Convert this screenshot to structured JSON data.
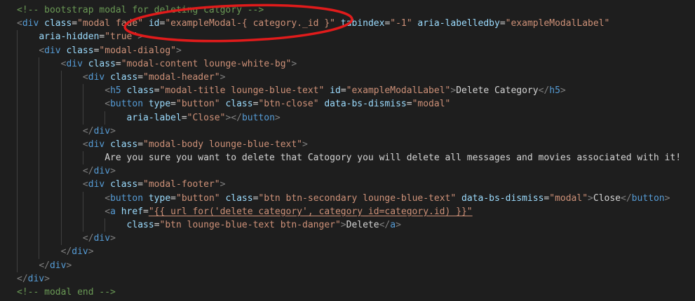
{
  "colors": {
    "background": "#1e1e1e",
    "punctuation": "#808080",
    "tag": "#569cd6",
    "attribute": "#9cdcfe",
    "string": "#ce9178",
    "text": "#d4d4d4",
    "comment": "#6a9955",
    "annotation": "#e01b1b"
  },
  "lines": [
    {
      "indent": 0,
      "tokens": [
        {
          "t": "comment",
          "v": "<!-- bootstrap modal for deleting catgory -->"
        }
      ]
    },
    {
      "indent": 0,
      "tokens": [
        {
          "t": "punct",
          "v": "<"
        },
        {
          "t": "tag",
          "v": "div"
        },
        {
          "t": "text",
          "v": " "
        },
        {
          "t": "attr",
          "v": "class"
        },
        {
          "t": "eq",
          "v": "="
        },
        {
          "t": "str",
          "v": "\"modal fade\""
        },
        {
          "t": "text",
          "v": " "
        },
        {
          "t": "attr",
          "v": "id"
        },
        {
          "t": "eq",
          "v": "="
        },
        {
          "t": "str",
          "v": "\"exampleModal-{ category._id }\""
        },
        {
          "t": "text",
          "v": " "
        },
        {
          "t": "attr",
          "v": "tabindex"
        },
        {
          "t": "eq",
          "v": "="
        },
        {
          "t": "str",
          "v": "\"-1\""
        },
        {
          "t": "text",
          "v": " "
        },
        {
          "t": "attr",
          "v": "aria-labelledby"
        },
        {
          "t": "eq",
          "v": "="
        },
        {
          "t": "str",
          "v": "\"exampleModalLabel\""
        }
      ]
    },
    {
      "indent": 1,
      "tokens": [
        {
          "t": "attr",
          "v": "aria-hidden"
        },
        {
          "t": "eq",
          "v": "="
        },
        {
          "t": "str",
          "v": "\"true\""
        },
        {
          "t": "punct",
          "v": ">"
        }
      ]
    },
    {
      "indent": 1,
      "tokens": [
        {
          "t": "punct",
          "v": "<"
        },
        {
          "t": "tag",
          "v": "div"
        },
        {
          "t": "text",
          "v": " "
        },
        {
          "t": "attr",
          "v": "class"
        },
        {
          "t": "eq",
          "v": "="
        },
        {
          "t": "str",
          "v": "\"modal-dialog\""
        },
        {
          "t": "punct",
          "v": ">"
        }
      ]
    },
    {
      "indent": 2,
      "tokens": [
        {
          "t": "punct",
          "v": "<"
        },
        {
          "t": "tag",
          "v": "div"
        },
        {
          "t": "text",
          "v": " "
        },
        {
          "t": "attr",
          "v": "class"
        },
        {
          "t": "eq",
          "v": "="
        },
        {
          "t": "str",
          "v": "\"modal-content lounge-white-bg\""
        },
        {
          "t": "punct",
          "v": ">"
        }
      ]
    },
    {
      "indent": 3,
      "tokens": [
        {
          "t": "punct",
          "v": "<"
        },
        {
          "t": "tag",
          "v": "div"
        },
        {
          "t": "text",
          "v": " "
        },
        {
          "t": "attr",
          "v": "class"
        },
        {
          "t": "eq",
          "v": "="
        },
        {
          "t": "str",
          "v": "\"modal-header\""
        },
        {
          "t": "punct",
          "v": ">"
        }
      ]
    },
    {
      "indent": 4,
      "tokens": [
        {
          "t": "punct",
          "v": "<"
        },
        {
          "t": "tag",
          "v": "h5"
        },
        {
          "t": "text",
          "v": " "
        },
        {
          "t": "attr",
          "v": "class"
        },
        {
          "t": "eq",
          "v": "="
        },
        {
          "t": "str",
          "v": "\"modal-title lounge-blue-text\""
        },
        {
          "t": "text",
          "v": " "
        },
        {
          "t": "attr",
          "v": "id"
        },
        {
          "t": "eq",
          "v": "="
        },
        {
          "t": "str",
          "v": "\"exampleModalLabel\""
        },
        {
          "t": "punct",
          "v": ">"
        },
        {
          "t": "text",
          "v": "Delete Category"
        },
        {
          "t": "punct",
          "v": "</"
        },
        {
          "t": "tag",
          "v": "h5"
        },
        {
          "t": "punct",
          "v": ">"
        }
      ]
    },
    {
      "indent": 4,
      "tokens": [
        {
          "t": "punct",
          "v": "<"
        },
        {
          "t": "tag",
          "v": "button"
        },
        {
          "t": "text",
          "v": " "
        },
        {
          "t": "attr",
          "v": "type"
        },
        {
          "t": "eq",
          "v": "="
        },
        {
          "t": "str",
          "v": "\"button\""
        },
        {
          "t": "text",
          "v": " "
        },
        {
          "t": "attr",
          "v": "class"
        },
        {
          "t": "eq",
          "v": "="
        },
        {
          "t": "str",
          "v": "\"btn-close\""
        },
        {
          "t": "text",
          "v": " "
        },
        {
          "t": "attr",
          "v": "data-bs-dismiss"
        },
        {
          "t": "eq",
          "v": "="
        },
        {
          "t": "str",
          "v": "\"modal\""
        }
      ]
    },
    {
      "indent": 5,
      "tokens": [
        {
          "t": "attr",
          "v": "aria-label"
        },
        {
          "t": "eq",
          "v": "="
        },
        {
          "t": "str",
          "v": "\"Close\""
        },
        {
          "t": "punct",
          "v": "></"
        },
        {
          "t": "tag",
          "v": "button"
        },
        {
          "t": "punct",
          "v": ">"
        }
      ]
    },
    {
      "indent": 3,
      "tokens": [
        {
          "t": "punct",
          "v": "</"
        },
        {
          "t": "tag",
          "v": "div"
        },
        {
          "t": "punct",
          "v": ">"
        }
      ]
    },
    {
      "indent": 3,
      "tokens": [
        {
          "t": "punct",
          "v": "<"
        },
        {
          "t": "tag",
          "v": "div"
        },
        {
          "t": "text",
          "v": " "
        },
        {
          "t": "attr",
          "v": "class"
        },
        {
          "t": "eq",
          "v": "="
        },
        {
          "t": "str",
          "v": "\"modal-body lounge-blue-text\""
        },
        {
          "t": "punct",
          "v": ">"
        }
      ]
    },
    {
      "indent": 4,
      "tokens": [
        {
          "t": "text",
          "v": "Are you sure you want to delete that Catogory you will delete all messages and movies associated with it!"
        }
      ]
    },
    {
      "indent": 3,
      "tokens": [
        {
          "t": "punct",
          "v": "</"
        },
        {
          "t": "tag",
          "v": "div"
        },
        {
          "t": "punct",
          "v": ">"
        }
      ]
    },
    {
      "indent": 3,
      "tokens": [
        {
          "t": "punct",
          "v": "<"
        },
        {
          "t": "tag",
          "v": "div"
        },
        {
          "t": "text",
          "v": " "
        },
        {
          "t": "attr",
          "v": "class"
        },
        {
          "t": "eq",
          "v": "="
        },
        {
          "t": "str",
          "v": "\"modal-footer\""
        },
        {
          "t": "punct",
          "v": ">"
        }
      ]
    },
    {
      "indent": 4,
      "tokens": [
        {
          "t": "punct",
          "v": "<"
        },
        {
          "t": "tag",
          "v": "button"
        },
        {
          "t": "text",
          "v": " "
        },
        {
          "t": "attr",
          "v": "type"
        },
        {
          "t": "eq",
          "v": "="
        },
        {
          "t": "str",
          "v": "\"button\""
        },
        {
          "t": "text",
          "v": " "
        },
        {
          "t": "attr",
          "v": "class"
        },
        {
          "t": "eq",
          "v": "="
        },
        {
          "t": "str",
          "v": "\"btn btn-secondary lounge-blue-text\""
        },
        {
          "t": "text",
          "v": " "
        },
        {
          "t": "attr",
          "v": "data-bs-dismiss"
        },
        {
          "t": "eq",
          "v": "="
        },
        {
          "t": "str",
          "v": "\"modal\""
        },
        {
          "t": "punct",
          "v": ">"
        },
        {
          "t": "text",
          "v": "Close"
        },
        {
          "t": "punct",
          "v": "</"
        },
        {
          "t": "tag",
          "v": "button"
        },
        {
          "t": "punct",
          "v": ">"
        }
      ]
    },
    {
      "indent": 4,
      "tokens": [
        {
          "t": "punct",
          "v": "<"
        },
        {
          "t": "tag",
          "v": "a"
        },
        {
          "t": "text",
          "v": " "
        },
        {
          "t": "attr",
          "v": "href"
        },
        {
          "t": "eq",
          "v": "="
        },
        {
          "t": "str",
          "v": "\"{{ url_for('delete_category', category_id=category.id) }}\"",
          "link": true
        }
      ]
    },
    {
      "indent": 5,
      "tokens": [
        {
          "t": "attr",
          "v": "class"
        },
        {
          "t": "eq",
          "v": "="
        },
        {
          "t": "str",
          "v": "\"btn lounge-blue-text btn-danger\""
        },
        {
          "t": "punct",
          "v": ">"
        },
        {
          "t": "text",
          "v": "Delete"
        },
        {
          "t": "punct",
          "v": "</"
        },
        {
          "t": "tag",
          "v": "a"
        },
        {
          "t": "punct",
          "v": ">"
        }
      ]
    },
    {
      "indent": 3,
      "tokens": [
        {
          "t": "punct",
          "v": "</"
        },
        {
          "t": "tag",
          "v": "div"
        },
        {
          "t": "punct",
          "v": ">"
        }
      ]
    },
    {
      "indent": 2,
      "tokens": [
        {
          "t": "punct",
          "v": "</"
        },
        {
          "t": "tag",
          "v": "div"
        },
        {
          "t": "punct",
          "v": ">"
        }
      ]
    },
    {
      "indent": 1,
      "tokens": [
        {
          "t": "punct",
          "v": "</"
        },
        {
          "t": "tag",
          "v": "div"
        },
        {
          "t": "punct",
          "v": ">"
        }
      ]
    },
    {
      "indent": 0,
      "tokens": [
        {
          "t": "punct",
          "v": "</"
        },
        {
          "t": "tag",
          "v": "div"
        },
        {
          "t": "punct",
          "v": ">"
        }
      ]
    },
    {
      "indent": 0,
      "tokens": [
        {
          "t": "comment",
          "v": "<!-- modal end -->"
        }
      ]
    }
  ]
}
